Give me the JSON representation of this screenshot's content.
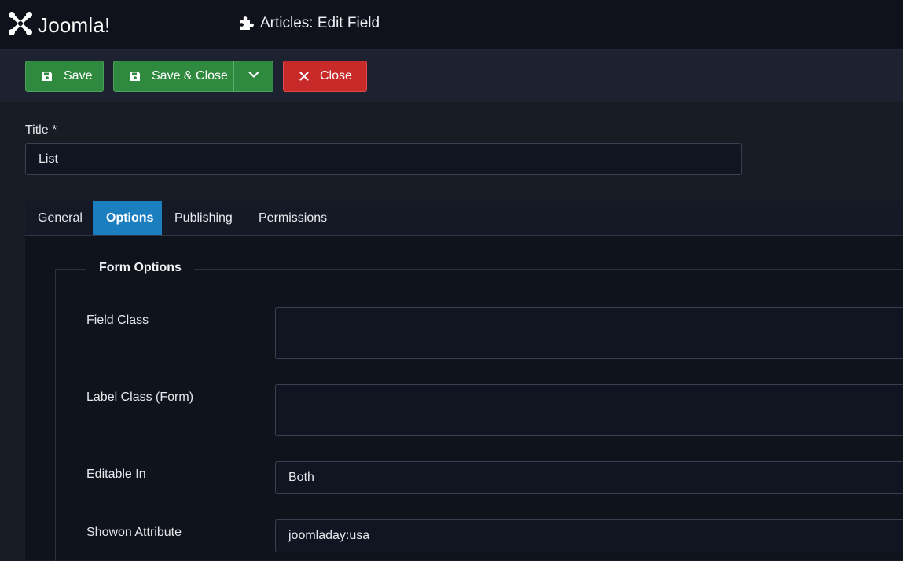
{
  "header": {
    "logo_text": "Joomla!",
    "page_title": "Articles: Edit Field"
  },
  "toolbar": {
    "save_label": "Save",
    "save_close_label": "Save & Close",
    "close_label": "Close"
  },
  "form": {
    "title_label": "Title *",
    "title_value": "List"
  },
  "tabs": [
    {
      "label": "General",
      "active": false
    },
    {
      "label": "Options",
      "active": true
    },
    {
      "label": "Publishing",
      "active": false
    },
    {
      "label": "Permissions",
      "active": false
    }
  ],
  "options": {
    "legend": "Form Options",
    "fields": [
      {
        "label": "Field Class",
        "value": ""
      },
      {
        "label": "Label Class (Form)",
        "value": ""
      },
      {
        "label": "Editable In",
        "value": "Both"
      },
      {
        "label": "Showon Attribute",
        "value": "joomladay:usa"
      }
    ]
  },
  "colors": {
    "success": "#2f8a3f",
    "danger": "#c82a2a",
    "active_tab": "#1b7fbf",
    "background": "#181c25"
  },
  "icons": {
    "logo": "joomla-logo-icon",
    "title": "puzzle-piece-icon",
    "save": "floppy-disk-icon",
    "dropdown": "chevron-down-icon",
    "close": "close-x-icon"
  }
}
